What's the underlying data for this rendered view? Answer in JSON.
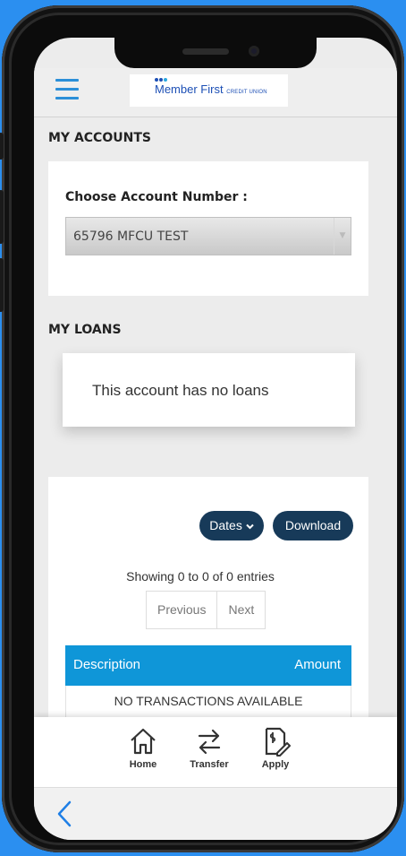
{
  "header": {
    "logo_name": "Member First",
    "logo_sub": "CREDIT UNION"
  },
  "accounts": {
    "title": "MY ACCOUNTS",
    "choose_label": "Choose Account Number :",
    "selected_account": "65796 MFCU TEST"
  },
  "loans": {
    "title": "MY LOANS",
    "empty_message": "This account has no loans"
  },
  "transactions": {
    "dates_label": "Dates",
    "download_label": "Download",
    "showing_text": "Showing 0 to 0 of 0 entries",
    "previous_label": "Previous",
    "next_label": "Next",
    "columns": [
      "Description",
      "Amount"
    ],
    "empty_text": "NO TRANSACTIONS AVAILABLE"
  },
  "bottom_nav": [
    {
      "label": "Home",
      "icon": "home-icon"
    },
    {
      "label": "Transfer",
      "icon": "transfer-icon"
    },
    {
      "label": "Apply",
      "icon": "apply-icon"
    }
  ],
  "colors": {
    "accent": "#0f96d8",
    "pill": "#173a59",
    "background": "#2b8ff0"
  }
}
